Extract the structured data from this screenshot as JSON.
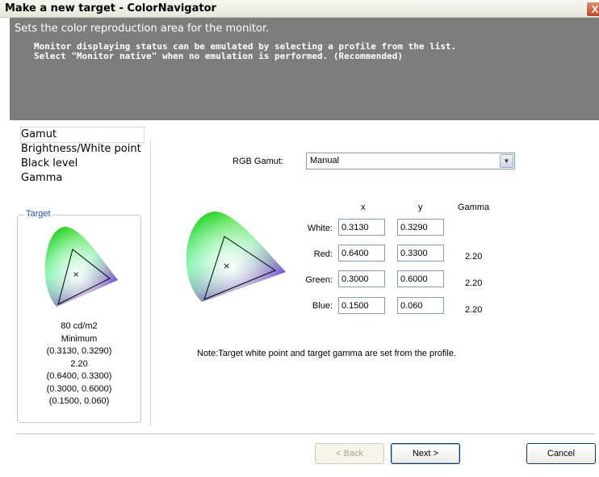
{
  "window": {
    "title": "Make a new target - ColorNavigator",
    "close_glyph": "X"
  },
  "header": {
    "title": "Sets the color reproduction area for the monitor.",
    "desc_line1": "Monitor displaying status can be emulated by selecting a profile from the list.",
    "desc_line2": "Select \"Monitor native\" when no emulation is performed. (Recommended)"
  },
  "nav": {
    "items": [
      {
        "label": "Gamut",
        "active": true
      },
      {
        "label": "Brightness/White point",
        "active": false
      },
      {
        "label": "Black level",
        "active": false
      },
      {
        "label": "Gamma",
        "active": false
      }
    ]
  },
  "target": {
    "legend": "Target",
    "lines": [
      "80 cd/m2",
      "Minimum",
      "(0.3130, 0.3290)",
      "2.20",
      "(0.6400, 0.3300)",
      "(0.3000, 0.6000)",
      "(0.1500, 0.060)"
    ]
  },
  "gamut": {
    "label": "RGB Gamut:",
    "selected": "Manual"
  },
  "table": {
    "headers": {
      "x": "x",
      "y": "y",
      "gamma": "Gamma"
    },
    "rows": [
      {
        "label": "White:",
        "x": "0.3130",
        "y": "0.3290",
        "gamma": ""
      },
      {
        "label": "Red:",
        "x": "0.6400",
        "y": "0.3300",
        "gamma": "2.20"
      },
      {
        "label": "Green:",
        "x": "0.3000",
        "y": "0.6000",
        "gamma": "2.20"
      },
      {
        "label": "Blue:",
        "x": "0.1500",
        "y": "0.060",
        "gamma": "2.20"
      }
    ]
  },
  "note": "Note:Target white point and target gamma are set from the profile.",
  "buttons": {
    "back": "< Back",
    "next": "Next >",
    "cancel": "Cancel"
  },
  "colors": {
    "header_bg": "#7d7d7d",
    "close_button": "#c6451f",
    "legend_text": "#1f4fb5"
  }
}
